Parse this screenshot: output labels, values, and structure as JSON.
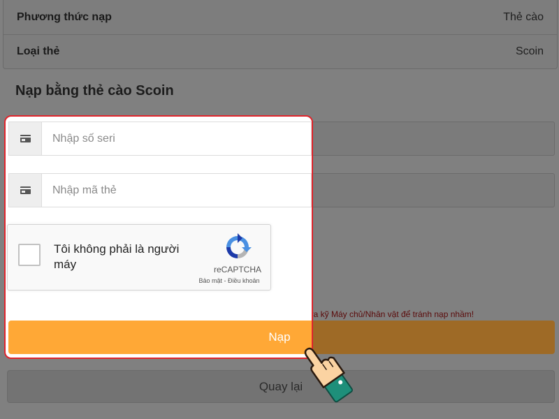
{
  "info": {
    "rows": [
      {
        "label": "Phương thức nạp",
        "value": "Thẻ cào"
      },
      {
        "label": "Loại thẻ",
        "value": "Scoin"
      }
    ]
  },
  "section_title": "Nạp bằng thẻ cào Scoin",
  "form": {
    "serial": {
      "placeholder": "Nhập số seri",
      "icon": "credit-card-icon"
    },
    "code": {
      "placeholder": "Nhập mã thẻ",
      "icon": "credit-card-icon"
    }
  },
  "captcha": {
    "label": "Tôi không phải là người máy",
    "brand": "reCAPTCHA",
    "links": "Bảo mật - Điều khoản"
  },
  "notice": "Quý khách kiểm tra kỹ Máy chủ/Nhân vật để tránh nạp nhầm!",
  "buttons": {
    "submit": "Nạp",
    "back": "Quay lại"
  },
  "colors": {
    "highlight_border": "#e0242b",
    "submit_bg": "#ffa836",
    "notice_text": "#5a0a0a"
  }
}
